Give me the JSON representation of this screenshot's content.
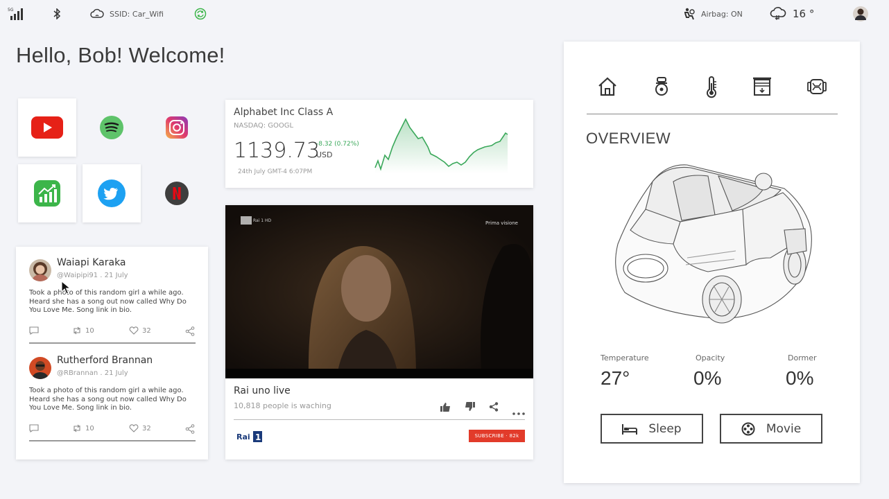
{
  "statusbar": {
    "network_badge": "5G",
    "wifi_label": "SSID: Car_Wifi",
    "airbag_label": "Airbag: ON",
    "weather_temp": "16 °"
  },
  "header": {
    "greeting": "Hello, Bob! Welcome!"
  },
  "apps": [
    {
      "name": "YouTube",
      "icon": "youtube-icon",
      "color": "#e62117"
    },
    {
      "name": "Spotify",
      "icon": "spotify-icon",
      "color": "#5ec36a"
    },
    {
      "name": "Instagram",
      "icon": "instagram-icon",
      "color": "#d6307e"
    },
    {
      "name": "Stocks",
      "icon": "stocks-icon",
      "color": "#3cb54a"
    },
    {
      "name": "Twitter",
      "icon": "twitter-icon",
      "color": "#1da1f2"
    },
    {
      "name": "Netflix",
      "icon": "netflix-icon",
      "color": "#e50914"
    }
  ],
  "stock": {
    "name": "Alphabet Inc Class A",
    "exchange": "NASDAQ: GOOGL",
    "price": "1139.73",
    "change": "-8.32 (0.72%)",
    "currency": "USD",
    "date": "24th July GMT-4 6:07PM",
    "accent": "#3aa85a"
  },
  "tweets": [
    {
      "name": "Waiapi Karaka",
      "handle": "@Waipipi91 . 21 July",
      "text": "Took a photo of this random girl a while ago. Heard she has a song out now called Why Do You Love Me. Song link in bio.",
      "retweets": "10",
      "likes": "32"
    },
    {
      "name": "Rutherford Brannan",
      "handle": "@RBrannan . 21 July",
      "text": "Took a photo of this random girl a while ago. Heard she has a song out now called Why Do You Love Me. Song link in bio.",
      "retweets": "10",
      "likes": "32"
    }
  ],
  "video": {
    "channel_badge": "Rai 1 HD",
    "overlay": "Prima visione",
    "title": "Rai uno live",
    "viewers": "10,818 people is waching",
    "logo": "Rai 1",
    "subscribe": "SUBSCRIBE · 82k"
  },
  "panel": {
    "nav": [
      "home-icon",
      "seat-icon",
      "thermometer-icon",
      "window-shade-icon",
      "car-front-icon"
    ],
    "title": "OVERVIEW",
    "stats": [
      {
        "label": "Temperature",
        "value": "27°"
      },
      {
        "label": "Opacity",
        "value": "0%"
      },
      {
        "label": "Dormer",
        "value": "0%"
      }
    ],
    "modes": [
      {
        "label": "Sleep",
        "icon": "bed-icon"
      },
      {
        "label": "Movie",
        "icon": "film-reel-icon"
      }
    ]
  }
}
